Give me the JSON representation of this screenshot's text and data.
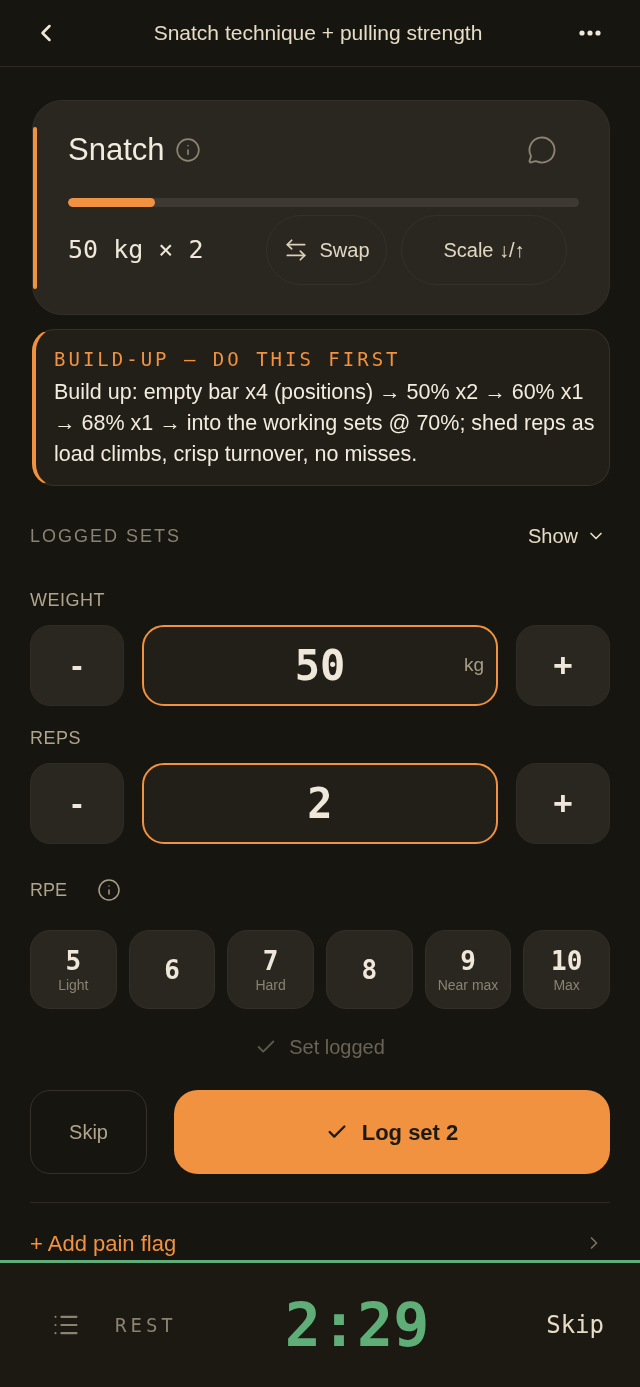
{
  "header": {
    "title": "Snatch technique + pulling strength"
  },
  "exercise": {
    "name": "Snatch",
    "progress": {
      "level": 0.17
    },
    "prescription": "50 kg × 2",
    "actions": [
      {
        "kind": "swap",
        "label": "Swap"
      },
      {
        "kind": "scale",
        "label": "Scale ↓/↑"
      }
    ]
  },
  "buildup": {
    "heading": "BUILD-UP — DO THIS FIRST",
    "text": "Build up: empty bar x4 (positions) → 50% x2 → 60% x1 → 68% x1 → into the working sets @ 70%; shed reps as load climbs, crisp turnover, no misses."
  },
  "logged_sets": {
    "label": "LOGGED SETS",
    "toggle": "Show",
    "expanded": false
  },
  "steppers": [
    {
      "label": "WEIGHT",
      "decrement": "-",
      "value": "50",
      "unit": "kg",
      "increment": "+"
    },
    {
      "label": "REPS",
      "decrement": "-",
      "value": "2",
      "increment": "+"
    }
  ],
  "rpe": {
    "label": "RPE",
    "options": [
      {
        "value": "5",
        "caption": "Light",
        "selected": false
      },
      {
        "value": "6",
        "selected": false
      },
      {
        "value": "7",
        "caption": "Hard",
        "selected": false
      },
      {
        "value": "8",
        "selected": false
      },
      {
        "value": "9",
        "caption": "Near max",
        "selected": false
      },
      {
        "value": "10",
        "caption": "Max",
        "selected": false
      }
    ]
  },
  "status": {
    "text": "Set logged"
  },
  "buttons": {
    "skip": "Skip",
    "log": "Log set 2"
  },
  "pain_flag": {
    "label": "+ Add pain flag"
  },
  "rest": {
    "label": "REST",
    "time": "2:29",
    "skip": "Skip"
  }
}
